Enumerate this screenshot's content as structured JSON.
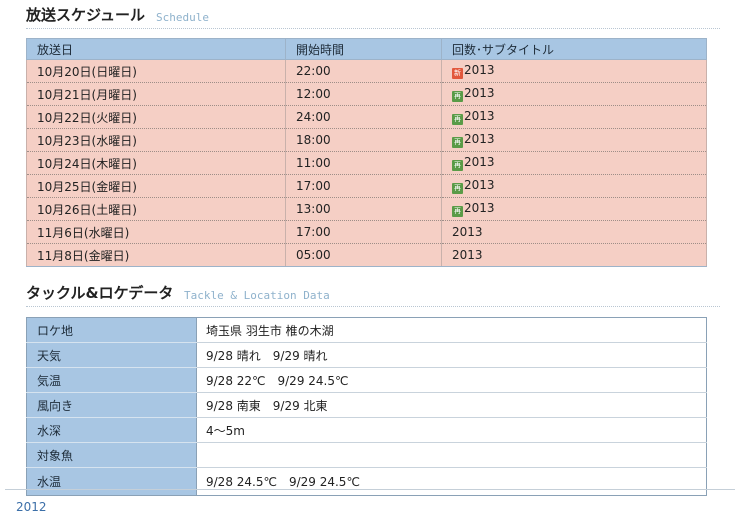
{
  "schedule": {
    "title": "放送スケジュール",
    "title_en": "Schedule",
    "headers": [
      "放送日",
      "開始時間",
      "回数･サブタイトル"
    ],
    "rows": [
      {
        "date": "10月20日(日曜日)",
        "time": "22:00",
        "badge": "新",
        "badge_type": "new",
        "episode": "2013"
      },
      {
        "date": "10月21日(月曜日)",
        "time": "12:00",
        "badge": "再",
        "badge_type": "re",
        "episode": "2013"
      },
      {
        "date": "10月22日(火曜日)",
        "time": "24:00",
        "badge": "再",
        "badge_type": "re",
        "episode": "2013"
      },
      {
        "date": "10月23日(水曜日)",
        "time": "18:00",
        "badge": "再",
        "badge_type": "re",
        "episode": "2013"
      },
      {
        "date": "10月24日(木曜日)",
        "time": "11:00",
        "badge": "再",
        "badge_type": "re",
        "episode": "2013"
      },
      {
        "date": "10月25日(金曜日)",
        "time": "17:00",
        "badge": "再",
        "badge_type": "re",
        "episode": "2013"
      },
      {
        "date": "10月26日(土曜日)",
        "time": "13:00",
        "badge": "再",
        "badge_type": "re",
        "episode": "2013"
      },
      {
        "date": "11月6日(水曜日)",
        "time": "17:00",
        "badge": "",
        "badge_type": "",
        "episode": "2013"
      },
      {
        "date": "11月8日(金曜日)",
        "time": "05:00",
        "badge": "",
        "badge_type": "",
        "episode": "2013"
      }
    ]
  },
  "tackle": {
    "title": "タックル&ロケデータ",
    "title_en": "Tackle & Location Data",
    "rows": [
      {
        "label": "ロケ地",
        "value": "埼玉県 羽生市 椎の木湖"
      },
      {
        "label": "天気",
        "value": "9/28 晴れ　9/29 晴れ"
      },
      {
        "label": "気温",
        "value": "9/28 22℃　9/29 24.5℃"
      },
      {
        "label": "風向き",
        "value": "9/28 南東　9/29 北東"
      },
      {
        "label": "水深",
        "value": "4〜5m"
      },
      {
        "label": "対象魚",
        "value": ""
      },
      {
        "label": "水温",
        "value": "9/28 24.5℃　9/29 24.5℃"
      }
    ]
  },
  "footer": {
    "year": "2012"
  },
  "colors": {
    "header_bg": "#a8c6e3",
    "schedule_row_bg": "#f5cfc5",
    "badge_new": "#e2573c",
    "badge_re": "#5a9b47",
    "link": "#3c6fa8"
  }
}
